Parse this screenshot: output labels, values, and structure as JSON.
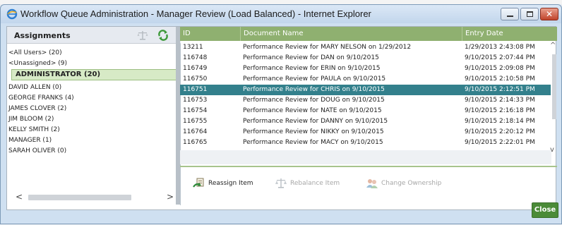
{
  "window": {
    "title": "Workflow Queue Administration - Manager Review (Load Balanced) - Internet Explorer",
    "close_glyph": "✕"
  },
  "assignments": {
    "title": "Assignments",
    "users": [
      "<All Users> (20)",
      "<Unassigned> (9)",
      "ADMINISTRATOR (20)",
      "DAVID ALLEN (0)",
      "GEORGE FRANKS (4)",
      "JAMES CLOVER (2)",
      "JIM BLOOM (2)",
      "KELLY SMITH (2)",
      "MANAGER (1)",
      "SARAH OLIVER (0)"
    ],
    "selected_user": "ADMINISTRATOR (20)",
    "scroll_left": "<",
    "scroll_right": ">"
  },
  "grid": {
    "columns": [
      "ID",
      "Document Name",
      "Entry Date"
    ],
    "rows": [
      {
        "id": "13211",
        "doc": "Performance Review for MARY NELSON on 1/29/2012",
        "date": "1/29/2013 2:43:08 PM"
      },
      {
        "id": "116748",
        "doc": "Performance Review for DAN on 9/10/2015",
        "date": "9/10/2015 2:07:44 PM"
      },
      {
        "id": "116749",
        "doc": "Performance Review for ERIN on 9/10/2015",
        "date": "9/10/2015 2:09:08 PM"
      },
      {
        "id": "116750",
        "doc": "Performance Review for PAULA on 9/10/2015",
        "date": "9/10/2015 2:10:58 PM"
      },
      {
        "id": "116751",
        "doc": "Performance Review for CHRIS on 9/10/2015",
        "date": "9/10/2015 2:12:51 PM"
      },
      {
        "id": "116753",
        "doc": "Performance Review for DOUG on 9/10/2015",
        "date": "9/10/2015 2:14:33 PM"
      },
      {
        "id": "116754",
        "doc": "Performance Review for NATE on 9/10/2015",
        "date": "9/10/2015 2:16:18 PM"
      },
      {
        "id": "116755",
        "doc": "Performance Review for DANNY on 9/10/2015",
        "date": "9/10/2015 2:18:14 PM"
      },
      {
        "id": "116764",
        "doc": "Performance Review for NIKKY on 9/10/2015",
        "date": "9/10/2015 2:20:12 PM"
      },
      {
        "id": "116765",
        "doc": "Performance Review for MACY on 9/10/2015",
        "date": "9/10/2015 2:22:01 PM"
      }
    ],
    "selected_id": "116751",
    "scroll_up": "^",
    "scroll_down": "v"
  },
  "actions": {
    "reassign": "Reassign Item",
    "rebalance": "Rebalance Item",
    "ownership": "Change Ownership"
  },
  "footer": {
    "close": "Close"
  },
  "icons": {
    "ie": "ie-icon",
    "scale": "scale-icon",
    "refresh": "refresh-icon",
    "reassign": "reassign-icon",
    "rebalance": "rebalance-icon",
    "ownership": "ownership-icon"
  },
  "colors": {
    "grid_header": "#8fb070",
    "selected_row": "#33808c",
    "selected_user": "#d7eac6",
    "close_button": "#4b8b38"
  }
}
